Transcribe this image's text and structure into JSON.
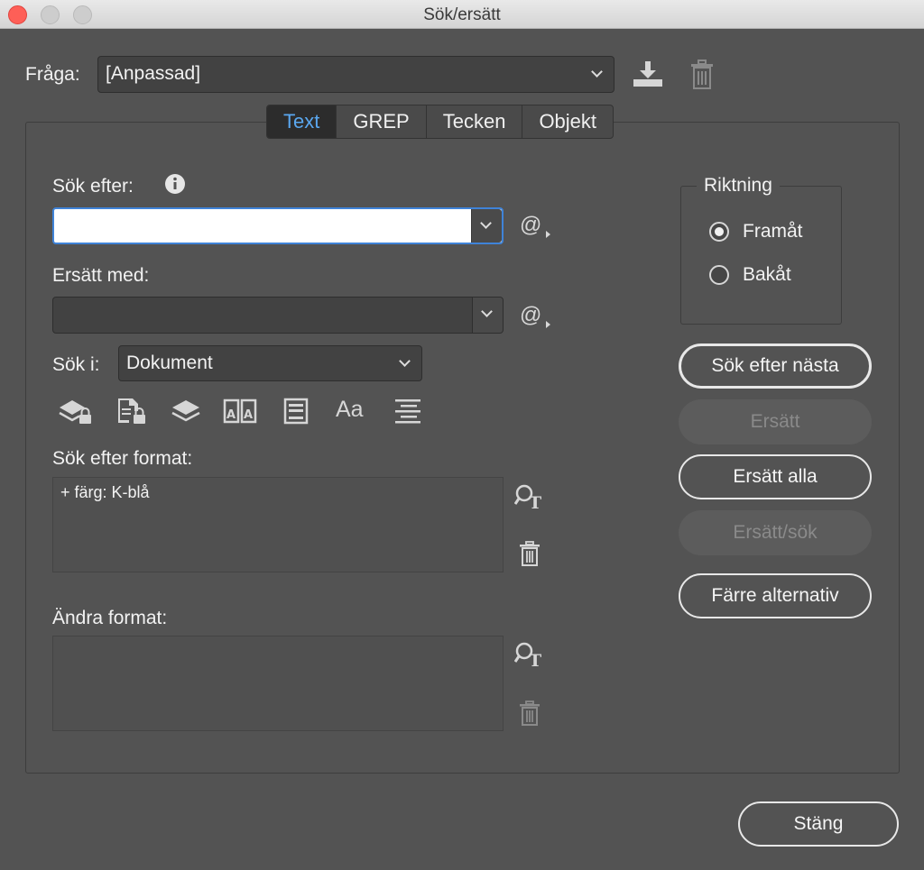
{
  "window": {
    "title": "Sök/ersätt"
  },
  "query": {
    "label": "Fråga:",
    "value": "[Anpassad]"
  },
  "tabs": [
    {
      "label": "Text",
      "active": true
    },
    {
      "label": "GREP",
      "active": false
    },
    {
      "label": "Tecken",
      "active": false
    },
    {
      "label": "Objekt",
      "active": false
    }
  ],
  "search": {
    "label": "Sök efter:",
    "value": ""
  },
  "replace": {
    "label": "Ersätt med:",
    "value": ""
  },
  "scope": {
    "label": "Sök i:",
    "value": "Dokument"
  },
  "search_format": {
    "label": "Sök efter format:",
    "value": "+ färg: K-blå"
  },
  "change_format": {
    "label": "Ändra format:",
    "value": ""
  },
  "direction": {
    "label": "Riktning",
    "options": [
      {
        "label": "Framåt",
        "selected": true
      },
      {
        "label": "Bakåt",
        "selected": false
      }
    ]
  },
  "buttons": {
    "find_next": "Sök efter nästa",
    "replace": "Ersätt",
    "replace_all": "Ersätt alla",
    "replace_find": "Ersätt/sök",
    "fewer_options": "Färre alternativ",
    "close": "Stäng"
  },
  "at_symbol": "@",
  "case_glyph": "Aa",
  "colors": {
    "accent": "#3f83d8",
    "active_tab_text": "#5aa7ef",
    "background": "#535353"
  }
}
